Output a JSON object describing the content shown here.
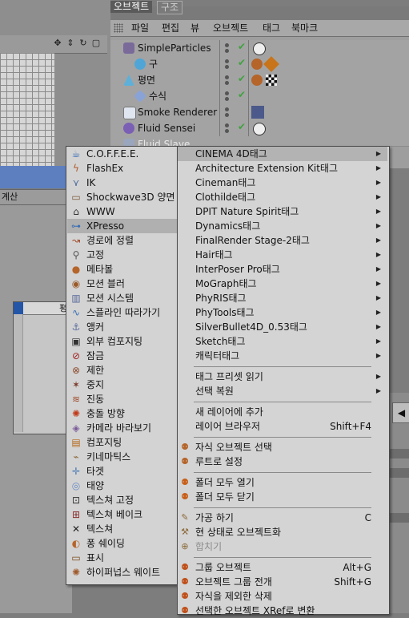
{
  "object_manager": {
    "tabs": [
      "오브젝트",
      "구조"
    ],
    "menus": [
      "파일",
      "편집",
      "뷰",
      "오브젝트",
      "태그",
      "북마크"
    ],
    "rows": [
      {
        "name": "SimpleParticles"
      },
      {
        "name": "구"
      },
      {
        "name": "평면"
      },
      {
        "name": "수식"
      },
      {
        "name": "Smoke Renderer"
      },
      {
        "name": "Fluid Sensei"
      },
      {
        "name": "Fluid Slave"
      }
    ]
  },
  "left_area": {
    "label": "계산",
    "node_title": "평"
  },
  "submenu_left": {
    "items": [
      {
        "label": "C.O.F.F.E.E.",
        "icon": "coffee-cup-icon"
      },
      {
        "label": "FlashEx",
        "icon": "flash-icon"
      },
      {
        "label": "IK",
        "icon": "ik-chain-icon"
      },
      {
        "label": "Shockwave3D 양면",
        "icon": "shockwave-icon"
      },
      {
        "label": "WWW",
        "icon": "house-icon"
      },
      {
        "label": "XPresso",
        "icon": "xpresso-icon"
      },
      {
        "label": "경로에 정렬",
        "icon": "align-path-icon"
      },
      {
        "label": "고정",
        "icon": "pin-icon"
      },
      {
        "label": "메타볼",
        "icon": "metaball-icon"
      },
      {
        "label": "모션 블러",
        "icon": "motion-blur-icon"
      },
      {
        "label": "모션 시스템",
        "icon": "motion-system-icon"
      },
      {
        "label": "스플라인 따라가기",
        "icon": "spline-follow-icon"
      },
      {
        "label": "앵커",
        "icon": "anchor-icon"
      },
      {
        "label": "외부 컴포지팅",
        "icon": "external-compositing-icon"
      },
      {
        "label": "잠금",
        "icon": "lock-icon"
      },
      {
        "label": "제한",
        "icon": "restriction-icon"
      },
      {
        "label": "중지",
        "icon": "stop-icon"
      },
      {
        "label": "진동",
        "icon": "vibrate-icon"
      },
      {
        "label": "충돌 방향",
        "icon": "collision-icon"
      },
      {
        "label": "카메라 바라보기",
        "icon": "look-at-camera-icon"
      },
      {
        "label": "컴포지팅",
        "icon": "compositing-icon"
      },
      {
        "label": "키네마틱스",
        "icon": "kinematics-icon"
      },
      {
        "label": "타겟",
        "icon": "target-icon"
      },
      {
        "label": "태양",
        "icon": "sun-icon"
      },
      {
        "label": "텍스쳐 고정",
        "icon": "texture-fix-icon"
      },
      {
        "label": "텍스쳐 베이크",
        "icon": "bake-texture-icon"
      },
      {
        "label": "텍스쳐",
        "icon": "texture-icon"
      },
      {
        "label": "퐁 쉐이딩",
        "icon": "phong-icon"
      },
      {
        "label": "표시",
        "icon": "display-icon"
      },
      {
        "label": "하이퍼넙스 웨이트",
        "icon": "hypernurbs-weight-icon"
      }
    ],
    "selected_index": 5
  },
  "context_menu": {
    "groups": [
      [
        {
          "label": "CINEMA 4D태그",
          "submenu": true
        },
        {
          "label": "Architecture Extension Kit태그",
          "submenu": true
        },
        {
          "label": "Cineman태그",
          "submenu": true
        },
        {
          "label": "Clothilde태그",
          "submenu": true
        },
        {
          "label": "DPIT Nature Spirit태그",
          "submenu": true
        },
        {
          "label": "Dynamics태그",
          "submenu": true
        },
        {
          "label": "FinalRender Stage-2태그",
          "submenu": true
        },
        {
          "label": "Hair태그",
          "submenu": true
        },
        {
          "label": "InterPoser Pro태그",
          "submenu": true
        },
        {
          "label": "MoGraph태그",
          "submenu": true
        },
        {
          "label": "PhyRIS태그",
          "submenu": true
        },
        {
          "label": "PhyTools태그",
          "submenu": true
        },
        {
          "label": "SilverBullet4D_0.53태그",
          "submenu": true
        },
        {
          "label": "Sketch태그",
          "submenu": true
        },
        {
          "label": "캐릭터태그",
          "submenu": true
        }
      ],
      [
        {
          "label": "태그 프리셋 읽기",
          "submenu": true
        },
        {
          "label": "선택 복원",
          "submenu": true
        }
      ],
      [
        {
          "label": "새 레이어에 추가"
        },
        {
          "label": "레이어 브라우저",
          "shortcut": "Shift+F4"
        }
      ],
      [
        {
          "label": "자식 오브젝트 선택"
        },
        {
          "label": "루트로 설정"
        }
      ],
      [
        {
          "label": "폴더 모두 열기"
        },
        {
          "label": "폴더 모두 닫기"
        }
      ],
      [
        {
          "label": "가공 하기",
          "shortcut": "C"
        },
        {
          "label": "현 상태로 오브젝트화"
        },
        {
          "label": "합치기",
          "disabled": true
        }
      ],
      [
        {
          "label": "그룹 오브젝트",
          "shortcut": "Alt+G"
        },
        {
          "label": "오브젝트 그룹 전개",
          "shortcut": "Shift+G"
        },
        {
          "label": "자식을 제외한 삭제"
        },
        {
          "label": "선택한 오브젝트 XRef로 변환"
        }
      ]
    ]
  }
}
